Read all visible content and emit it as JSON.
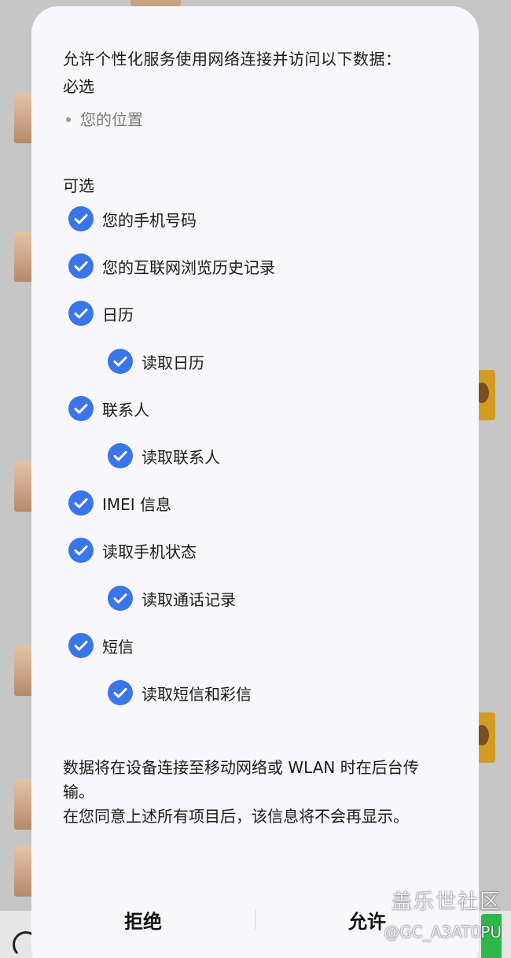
{
  "dialog": {
    "intro": "允许个性化服务使用网络连接并访问以下数据：",
    "required_title": "必选",
    "required_items": [
      "您的位置"
    ],
    "optional_title": "可选",
    "permissions": [
      {
        "label": "您的手机号码",
        "checked": true
      },
      {
        "label": "您的互联网浏览历史记录",
        "checked": true
      },
      {
        "label": "日历",
        "checked": true
      },
      {
        "label": "读取日历",
        "checked": true
      },
      {
        "label": "联系人",
        "checked": true
      },
      {
        "label": "读取联系人",
        "checked": true
      },
      {
        "label": "IMEI 信息",
        "checked": true
      },
      {
        "label": "读取手机状态",
        "checked": true
      },
      {
        "label": "读取通话记录",
        "checked": true
      },
      {
        "label": "短信",
        "checked": true
      },
      {
        "label": "读取短信和彩信",
        "checked": true
      }
    ],
    "footer_line1": "数据将在设备连接至移动网络或 WLAN 时在后台传输。",
    "footer_line2": "在您同意上述所有项目后，该信息将不会再显示。",
    "deny_label": "拒绝",
    "allow_label": "允许"
  },
  "watermark": {
    "site": "盖乐世社区",
    "user": "@GC_A3AT0PU"
  },
  "colors": {
    "accent": "#3a76ea",
    "dialog_bg": "#f8f8fc",
    "scrim": "#c6c6c6"
  },
  "icons": {
    "check": "check-circle-icon"
  }
}
